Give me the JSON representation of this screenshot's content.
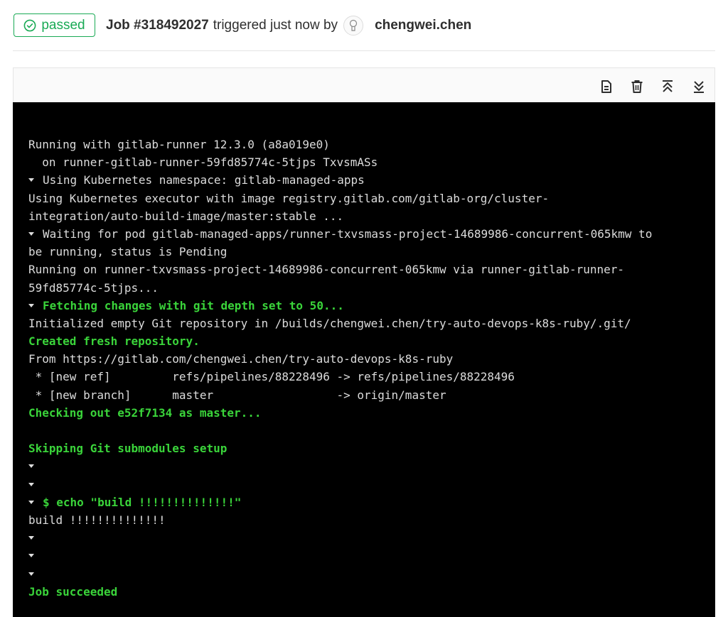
{
  "header": {
    "status": "passed",
    "job_id": "Job #318492027",
    "triggered_text": "triggered just now by",
    "username": "chengwei.chen"
  },
  "toolbar": {
    "buttons": [
      "raw-log-icon",
      "erase-log-icon",
      "scroll-to-top-icon",
      "scroll-to-bottom-icon"
    ]
  },
  "log": {
    "lines": [
      {
        "caret": false,
        "green": false,
        "text": "Running with gitlab-runner 12.3.0 (a8a019e0)"
      },
      {
        "caret": false,
        "green": false,
        "text": "  on runner-gitlab-runner-59fd85774c-5tjps TxvsmASs"
      },
      {
        "caret": true,
        "green": false,
        "text": "Using Kubernetes namespace: gitlab-managed-apps"
      },
      {
        "caret": false,
        "green": false,
        "text": "Using Kubernetes executor with image registry.gitlab.com/gitlab-org/cluster-"
      },
      {
        "caret": false,
        "green": false,
        "text": "integration/auto-build-image/master:stable ..."
      },
      {
        "caret": true,
        "green": false,
        "text": "Waiting for pod gitlab-managed-apps/runner-txvsmass-project-14689986-concurrent-065kmw to"
      },
      {
        "caret": false,
        "green": false,
        "text": "be running, status is Pending"
      },
      {
        "caret": false,
        "green": false,
        "text": "Running on runner-txvsmass-project-14689986-concurrent-065kmw via runner-gitlab-runner-"
      },
      {
        "caret": false,
        "green": false,
        "text": "59fd85774c-5tjps..."
      },
      {
        "caret": true,
        "green": true,
        "text": "Fetching changes with git depth set to 50..."
      },
      {
        "caret": false,
        "green": false,
        "text": "Initialized empty Git repository in /builds/chengwei.chen/try-auto-devops-k8s-ruby/.git/"
      },
      {
        "caret": false,
        "green": true,
        "text": "Created fresh repository."
      },
      {
        "caret": false,
        "green": false,
        "text": "From https://gitlab.com/chengwei.chen/try-auto-devops-k8s-ruby"
      },
      {
        "caret": false,
        "green": false,
        "text": " * [new ref]         refs/pipelines/88228496 -> refs/pipelines/88228496"
      },
      {
        "caret": false,
        "green": false,
        "text": " * [new branch]      master                  -> origin/master"
      },
      {
        "caret": false,
        "green": true,
        "text": "Checking out e52f7134 as master..."
      },
      {
        "caret": false,
        "green": false,
        "text": ""
      },
      {
        "caret": false,
        "green": true,
        "text": "Skipping Git submodules setup"
      },
      {
        "caret": true,
        "green": false,
        "text": ""
      },
      {
        "caret": true,
        "green": false,
        "text": ""
      },
      {
        "caret": true,
        "green": true,
        "text": "$ echo \"build !!!!!!!!!!!!!!\""
      },
      {
        "caret": false,
        "green": false,
        "text": "build !!!!!!!!!!!!!!"
      },
      {
        "caret": true,
        "green": false,
        "text": ""
      },
      {
        "caret": true,
        "green": false,
        "text": ""
      },
      {
        "caret": true,
        "green": false,
        "text": ""
      },
      {
        "caret": false,
        "green": true,
        "text": "Job succeeded"
      }
    ]
  },
  "colors": {
    "success": "#1aaa55",
    "log_bg": "#000000",
    "log_text": "#dcdcdc",
    "log_green": "#3ad43a"
  }
}
